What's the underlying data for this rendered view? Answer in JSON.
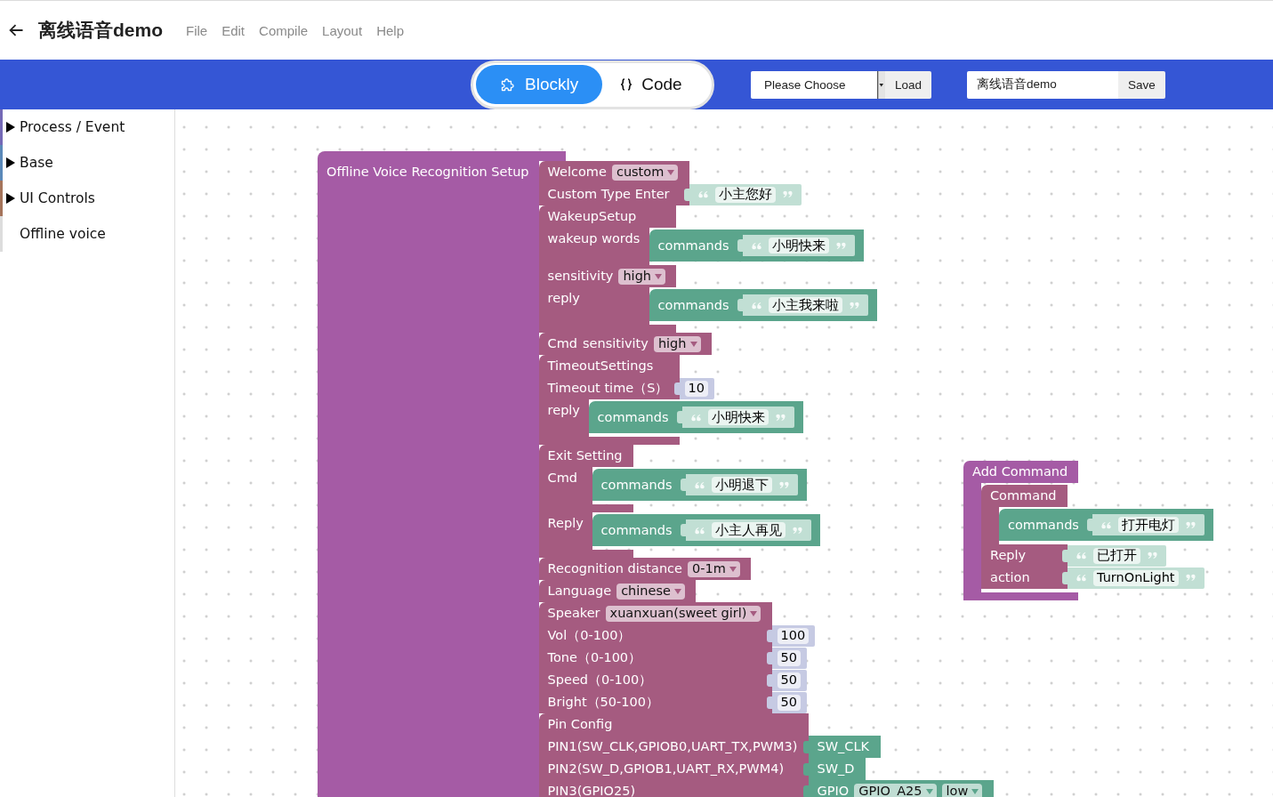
{
  "header": {
    "title": "离线语音demo",
    "menu": [
      "File",
      "Edit",
      "Compile",
      "Layout",
      "Help"
    ]
  },
  "toolbar": {
    "view_tabs": [
      {
        "label": "Blockly",
        "kind": "blocks",
        "selected": true
      },
      {
        "label": "Code",
        "kind": "code",
        "selected": false
      }
    ],
    "project_select": {
      "value": "Please Choose"
    },
    "load_button": "Load",
    "name_field": {
      "value": "离线语音demo"
    },
    "save_button": "Save"
  },
  "sidebar": {
    "items": [
      {
        "label": "Process / Event",
        "kind": "folder",
        "expanded": false,
        "color": "#7469b6"
      },
      {
        "label": "Base",
        "kind": "folder",
        "expanded": false,
        "color": "#5b89b9"
      },
      {
        "label": "UI Controls",
        "kind": "folder",
        "expanded": false,
        "color": "#a5745b"
      },
      {
        "label": "Offline voice",
        "kind": "leaf",
        "color": "#dddddd"
      }
    ]
  },
  "workspace": {
    "blocks": [
      {
        "kind": "setup",
        "rows": [
          {
            "kind": "statement",
            "label": "Offline Voice Recognition Setup",
            "blocks": [
              {
                "kind": "setting",
                "rows": [
                  {
                    "kind": "fields",
                    "items": [
                      {
                        "kind": "label",
                        "text": "Welcome"
                      },
                      {
                        "kind": "dropdown",
                        "value": "custom"
                      }
                    ]
                  },
                  {
                    "kind": "value",
                    "label": "Custom Type Enter",
                    "input": {
                      "kind": "text",
                      "value": "小主您好"
                    }
                  }
                ]
              },
              {
                "kind": "setting",
                "rows": [
                  {
                    "kind": "fields",
                    "items": [
                      {
                        "kind": "label",
                        "text": "WakeupSetup"
                      }
                    ]
                  },
                  {
                    "kind": "statement",
                    "label": "wakeup words",
                    "blocks": [
                      {
                        "kind": "commands",
                        "rows": [
                          {
                            "kind": "inline",
                            "label": "commands",
                            "input": {
                              "kind": "text",
                              "value": "小明快来"
                            }
                          }
                        ]
                      }
                    ]
                  },
                  {
                    "kind": "fields",
                    "items": [
                      {
                        "kind": "label",
                        "text": "sensitivity"
                      },
                      {
                        "kind": "dropdown",
                        "value": "high"
                      }
                    ]
                  },
                  {
                    "kind": "statement",
                    "label": "reply",
                    "blocks": [
                      {
                        "kind": "commands",
                        "rows": [
                          {
                            "kind": "inline",
                            "label": "commands",
                            "input": {
                              "kind": "text",
                              "value": "小主我来啦"
                            }
                          }
                        ]
                      }
                    ]
                  }
                ]
              },
              {
                "kind": "setting",
                "rows": [
                  {
                    "kind": "fields",
                    "items": [
                      {
                        "kind": "label",
                        "text": "Cmd"
                      },
                      {
                        "kind": "label",
                        "text": "sensitivity"
                      },
                      {
                        "kind": "dropdown",
                        "value": "high"
                      }
                    ]
                  }
                ]
              },
              {
                "kind": "setting",
                "rows": [
                  {
                    "kind": "fields",
                    "items": [
                      {
                        "kind": "label",
                        "text": "TimeoutSettings"
                      }
                    ]
                  },
                  {
                    "kind": "value",
                    "label": "Timeout time（S）",
                    "input": {
                      "kind": "number",
                      "value": "10"
                    }
                  },
                  {
                    "kind": "statement",
                    "label": "reply",
                    "blocks": [
                      {
                        "kind": "commands",
                        "rows": [
                          {
                            "kind": "inline",
                            "label": "commands",
                            "input": {
                              "kind": "text",
                              "value": "小明快来"
                            }
                          }
                        ]
                      }
                    ]
                  }
                ]
              },
              {
                "kind": "setting",
                "rows": [
                  {
                    "kind": "fields",
                    "items": [
                      {
                        "kind": "label",
                        "text": "Exit Setting"
                      }
                    ]
                  },
                  {
                    "kind": "statement",
                    "label": "Cmd",
                    "blocks": [
                      {
                        "kind": "commands",
                        "rows": [
                          {
                            "kind": "inline",
                            "label": "commands",
                            "input": {
                              "kind": "text",
                              "value": "小明退下"
                            }
                          }
                        ]
                      }
                    ]
                  },
                  {
                    "kind": "statement",
                    "label": "Reply",
                    "blocks": [
                      {
                        "kind": "commands",
                        "rows": [
                          {
                            "kind": "inline",
                            "label": "commands",
                            "input": {
                              "kind": "text",
                              "value": "小主人再见"
                            }
                          }
                        ]
                      }
                    ]
                  }
                ]
              },
              {
                "kind": "setting",
                "rows": [
                  {
                    "kind": "fields",
                    "items": [
                      {
                        "kind": "label",
                        "text": "Recognition distance"
                      },
                      {
                        "kind": "dropdown",
                        "value": "0-1m"
                      }
                    ]
                  }
                ]
              },
              {
                "kind": "setting",
                "rows": [
                  {
                    "kind": "fields",
                    "items": [
                      {
                        "kind": "label",
                        "text": "Language"
                      },
                      {
                        "kind": "dropdown",
                        "value": "chinese"
                      }
                    ]
                  }
                ]
              },
              {
                "kind": "setting",
                "rows": [
                  {
                    "kind": "fields",
                    "items": [
                      {
                        "kind": "label",
                        "text": "Speaker"
                      },
                      {
                        "kind": "dropdown",
                        "value": "xuanxuan(sweet girl)"
                      }
                    ]
                  },
                  {
                    "kind": "value",
                    "label": "Vol（0-100）",
                    "input": {
                      "kind": "number",
                      "value": "100"
                    }
                  },
                  {
                    "kind": "value",
                    "label": "Tone（0-100）",
                    "input": {
                      "kind": "number",
                      "value": "50"
                    }
                  },
                  {
                    "kind": "value",
                    "label": "Speed（0-100）",
                    "input": {
                      "kind": "number",
                      "value": "50"
                    }
                  },
                  {
                    "kind": "value",
                    "label": "Bright（50-100）",
                    "input": {
                      "kind": "number",
                      "value": "50"
                    }
                  }
                ]
              },
              {
                "kind": "setting",
                "rows": [
                  {
                    "kind": "fields",
                    "items": [
                      {
                        "kind": "label",
                        "text": "Pin Config"
                      }
                    ]
                  },
                  {
                    "kind": "value",
                    "label": "PIN1(SW_CLK,GPIOB0,UART_TX,PWM3)",
                    "input": {
                      "kind": "pin",
                      "rows": [
                        {
                          "kind": "fields",
                          "items": [
                            {
                              "kind": "label",
                              "text": "SW_CLK"
                            }
                          ]
                        }
                      ]
                    }
                  },
                  {
                    "kind": "value",
                    "label": "PIN2(SW_D,GPIOB1,UART_RX,PWM4)",
                    "input": {
                      "kind": "pin",
                      "rows": [
                        {
                          "kind": "fields",
                          "items": [
                            {
                              "kind": "label",
                              "text": "SW_D"
                            }
                          ]
                        }
                      ]
                    }
                  },
                  {
                    "kind": "value",
                    "label": "PIN3(GPIO25)",
                    "input": {
                      "kind": "pin",
                      "rows": [
                        {
                          "kind": "fields",
                          "items": [
                            {
                              "kind": "label",
                              "text": "GPIO"
                            },
                            {
                              "kind": "dropdown",
                              "value": "GPIO_A25"
                            },
                            {
                              "kind": "dropdown",
                              "value": "low"
                            }
                          ]
                        }
                      ]
                    }
                  }
                ]
              }
            ]
          }
        ]
      },
      {
        "kind": "container",
        "rows": [
          {
            "kind": "fields",
            "items": [
              {
                "kind": "label",
                "text": "Add Command"
              }
            ]
          },
          {
            "kind": "statement",
            "blocks": [
              {
                "kind": "setting",
                "rows": [
                  {
                    "kind": "fields",
                    "items": [
                      {
                        "kind": "label",
                        "text": "Command"
                      }
                    ]
                  },
                  {
                    "kind": "statement",
                    "blocks": [
                      {
                        "kind": "commands",
                        "rows": [
                          {
                            "kind": "inline",
                            "label": "commands",
                            "input": {
                              "kind": "text",
                              "value": "打开电灯"
                            }
                          }
                        ]
                      }
                    ]
                  },
                  {
                    "kind": "value",
                    "label": "Reply",
                    "input": {
                      "kind": "text",
                      "value": "已打开"
                    }
                  },
                  {
                    "kind": "value",
                    "label": "action",
                    "input": {
                      "kind": "text",
                      "value": "TurnOnLight"
                    }
                  }
                ]
              }
            ]
          }
        ]
      }
    ]
  }
}
